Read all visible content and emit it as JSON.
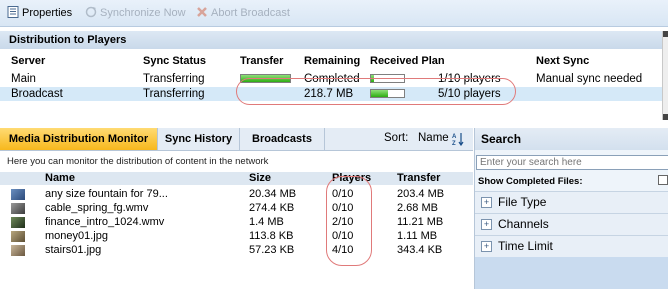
{
  "toolbar": {
    "properties": "Properties",
    "synchronize": "Synchronize Now",
    "abort": "Abort Broadcast"
  },
  "distribution": {
    "title": "Distribution to Players",
    "columns": [
      "Server",
      "Sync Status",
      "Transfer",
      "Remaining",
      "Received Plan",
      "Next Sync"
    ],
    "rows": [
      {
        "server": "Main",
        "status": "Transferring",
        "transfer_progress": 1.0,
        "remaining": "Completed",
        "plan_progress": 0.1,
        "plan_text": "1/10 players",
        "next_sync": "Manual sync needed"
      },
      {
        "server": "Broadcast",
        "status": "Transferring",
        "transfer_progress": 0.0,
        "remaining": "218.7 MB",
        "plan_progress": 0.5,
        "plan_text": "5/10 players",
        "next_sync": ""
      }
    ]
  },
  "tabs": [
    "Media Distribution Monitor",
    "Sync History",
    "Broadcasts"
  ],
  "sort": {
    "label": "Sort:",
    "value": "Name",
    "icon": "sort-az-icon"
  },
  "monitor": {
    "hint": "Here you can monitor the distribution of content in the network",
    "columns": [
      "Name",
      "Size",
      "Players",
      "Transfer"
    ],
    "rows": [
      {
        "name": "any size fountain for 79...",
        "size": "20.34 MB",
        "players": "0/10",
        "transfer": "203.4 MB"
      },
      {
        "name": "cable_spring_fg.wmv",
        "size": "274.4 KB",
        "players": "0/10",
        "transfer": "2.68 MB"
      },
      {
        "name": "finance_intro_1024.wmv",
        "size": "1.4 MB",
        "players": "2/10",
        "transfer": "11.21 MB"
      },
      {
        "name": "money01.jpg",
        "size": "113.8 KB",
        "players": "0/10",
        "transfer": "1.11 MB"
      },
      {
        "name": "stairs01.jpg",
        "size": "57.23 KB",
        "players": "4/10",
        "transfer": "343.4 KB"
      }
    ]
  },
  "search": {
    "title": "Search",
    "placeholder": "Enter your search here",
    "show_completed": "Show Completed Files:",
    "filters": [
      "File Type",
      "Channels",
      "Time Limit"
    ]
  },
  "colors": {
    "accent_tab": "#f7b81d",
    "selected_row": "#d5e9f8",
    "progress": "#2dad12",
    "annotation": "#e07a7a"
  }
}
